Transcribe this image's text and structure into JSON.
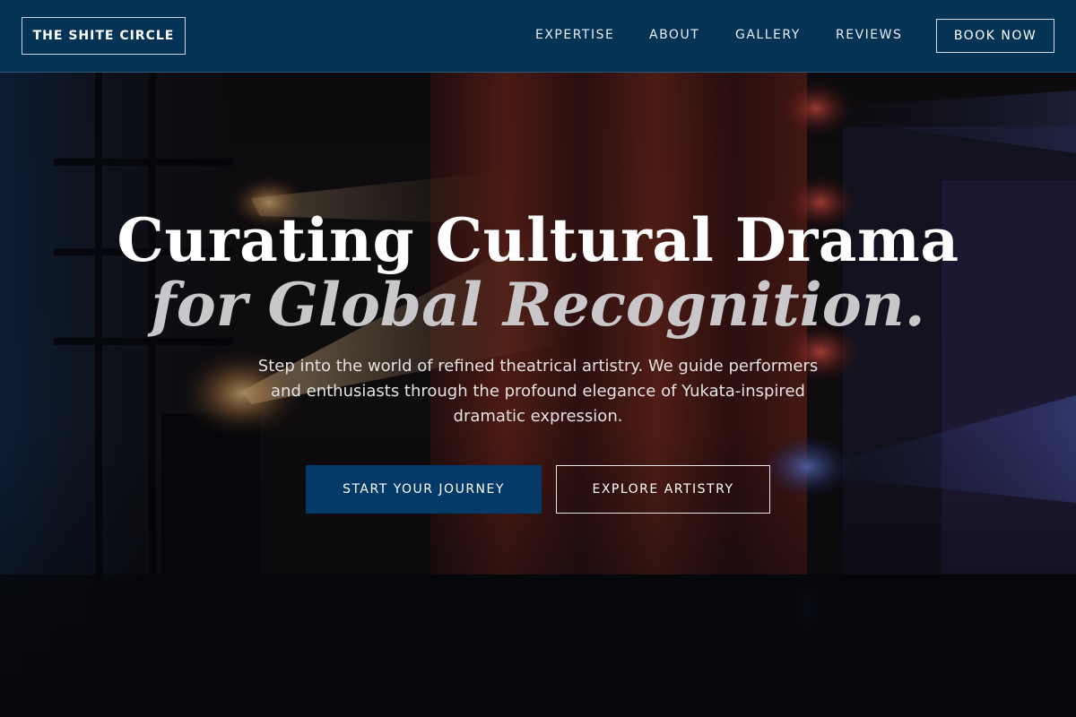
{
  "brand": {
    "name": "THE SHITE CIRCLE"
  },
  "nav": {
    "items": [
      {
        "label": "EXPERTISE"
      },
      {
        "label": "ABOUT"
      },
      {
        "label": "GALLERY"
      },
      {
        "label": "REVIEWS"
      }
    ],
    "cta_label": "BOOK NOW"
  },
  "hero": {
    "title_line1": "Curating Cultural Drama",
    "title_line2": "for Global Recognition.",
    "subtitle": "Step into the world of refined theatrical artistry. We guide performers and enthusiasts through the profound elegance of Yukata-inspired dramatic expression.",
    "primary_cta": "START YOUR JOURNEY",
    "secondary_cta": "EXPLORE ARTISTRY",
    "background_icon": "stage-lights-image"
  },
  "colors": {
    "header_bg": "#043356",
    "primary_button": "#043a68",
    "accent_red": "#b0301c",
    "accent_blue": "#2b55c8"
  }
}
